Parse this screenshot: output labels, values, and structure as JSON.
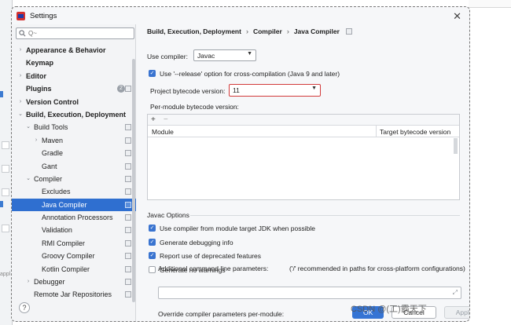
{
  "background": {
    "side_text": "appl"
  },
  "dialog": {
    "title": "Settings",
    "close_glyph": "✕",
    "help_glyph": "?"
  },
  "search": {
    "value": "",
    "placeholder": "Q~"
  },
  "tree": [
    {
      "label": "Appearance & Behavior",
      "bold": true,
      "arrow": "›",
      "level": 0
    },
    {
      "label": "Keymap",
      "bold": true,
      "arrow": "",
      "level": 0
    },
    {
      "label": "Editor",
      "bold": true,
      "arrow": "›",
      "level": 0
    },
    {
      "label": "Plugins",
      "bold": true,
      "arrow": "",
      "level": 0,
      "badge": "2"
    },
    {
      "label": "Version Control",
      "bold": true,
      "arrow": "›",
      "level": 0
    },
    {
      "label": "Build, Execution, Deployment",
      "bold": true,
      "arrow": "⌄",
      "level": 0
    },
    {
      "label": "Build Tools",
      "bold": false,
      "arrow": "⌄",
      "level": 1
    },
    {
      "label": "Maven",
      "bold": false,
      "arrow": "›",
      "level": 2
    },
    {
      "label": "Gradle",
      "bold": false,
      "arrow": "",
      "level": 2
    },
    {
      "label": "Gant",
      "bold": false,
      "arrow": "",
      "level": 2
    },
    {
      "label": "Compiler",
      "bold": false,
      "arrow": "⌄",
      "level": 1
    },
    {
      "label": "Excludes",
      "bold": false,
      "arrow": "",
      "level": 2
    },
    {
      "label": "Java Compiler",
      "bold": false,
      "arrow": "",
      "level": 2,
      "selected": true
    },
    {
      "label": "Annotation Processors",
      "bold": false,
      "arrow": "",
      "level": 2
    },
    {
      "label": "Validation",
      "bold": false,
      "arrow": "",
      "level": 2
    },
    {
      "label": "RMI Compiler",
      "bold": false,
      "arrow": "",
      "level": 2
    },
    {
      "label": "Groovy Compiler",
      "bold": false,
      "arrow": "",
      "level": 2
    },
    {
      "label": "Kotlin Compiler",
      "bold": false,
      "arrow": "",
      "level": 2
    },
    {
      "label": "Debugger",
      "bold": false,
      "arrow": "›",
      "level": 1
    },
    {
      "label": "Remote Jar Repositories",
      "bold": false,
      "arrow": "",
      "level": 1
    }
  ],
  "breadcrumb": [
    "Build, Execution, Deployment",
    "Compiler",
    "Java Compiler"
  ],
  "breadcrumb_sep": "›",
  "compiler": {
    "use_compiler_label": "Use compiler:",
    "use_compiler_value": "Javac",
    "release_option_label": "Use '--release' option for cross-compilation (Java 9 and later)",
    "release_option_checked": true,
    "bytecode_label": "Project bytecode version:",
    "bytecode_value": "11",
    "per_module_label": "Per-module bytecode version:"
  },
  "module_table": {
    "add": "+",
    "remove": "−",
    "columns": [
      "Module",
      "Target bytecode version"
    ],
    "rows": []
  },
  "javac": {
    "section_title": "Javac Options",
    "options": [
      {
        "label": "Use compiler from module target JDK when possible",
        "checked": true
      },
      {
        "label": "Generate debugging info",
        "checked": true
      },
      {
        "label": "Report use of deprecated features",
        "checked": true
      },
      {
        "label": "Generate no warnings",
        "checked": false
      }
    ],
    "params_label": "Additional command line parameters:",
    "params_hint": "('/' recommended in paths for cross-platform configurations)",
    "params_value": "",
    "expand_glyph": "⤢",
    "override_label": "Override compiler parameters per-module:"
  },
  "footer": {
    "ok": "OK",
    "cancel": "Cancel",
    "apply": "Apply"
  },
  "watermark": "CSDN @(工)霸天下",
  "icons": {
    "checked": "✓",
    "dropdown": "▼"
  },
  "colors": {
    "accent": "#3574d4",
    "selection": "#2f6fd0",
    "highlight": "#d23a3a"
  }
}
